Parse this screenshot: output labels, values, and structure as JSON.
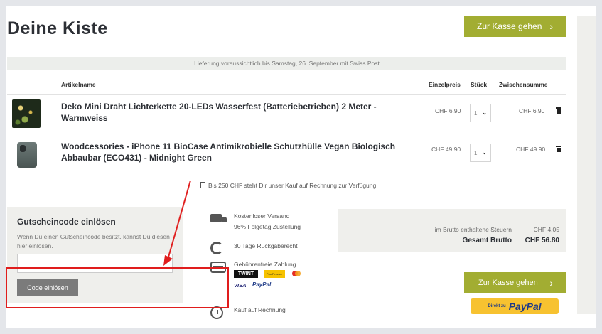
{
  "page": {
    "title": "Deine Kiste",
    "checkout_label": "Zur Kasse gehen",
    "chevron": "›",
    "delivery_note": "Lieferung voraussichtlich bis Samstag, 26. September mit Swiss Post"
  },
  "table": {
    "headers": [
      "Artikelname",
      "Einzelpreis",
      "Stück",
      "Zwischensumme"
    ],
    "rows": [
      {
        "name": "Deko Mini Draht Lichterkette 20-LEDs Wasserfest (Batteriebetrieben) 2 Meter - Warmweiss",
        "unit_price": "CHF 6.90",
        "qty": "1",
        "subtotal": "CHF 6.90"
      },
      {
        "name": "Woodcessories - iPhone 11 BioCase Antimikrobielle Schutzhülle Vegan Biologisch Abbaubar (ECO431) - Midnight Green",
        "unit_price": "CHF 49.90",
        "qty": "1",
        "subtotal": "CHF 49.90"
      }
    ]
  },
  "invoice_note": "Bis 250 CHF steht Dir unser Kauf auf Rechnung zur Verfügung!",
  "voucher": {
    "title": "Gutscheincode einlösen",
    "description": "Wenn Du einen Gutscheincode besitzt, kannst Du diesen hier einlösen.",
    "input_value": "",
    "button_label": "Code einlösen"
  },
  "features": [
    {
      "icon": "truck-icon",
      "line1": "Kostenloser Versand",
      "line2": "96% Folgetag Zustellung"
    },
    {
      "icon": "refresh-icon",
      "line1": "30 Tage Rückgaberecht",
      "line2": ""
    },
    {
      "icon": "credit-card-icon",
      "line1": "Gebührenfreie Zahlung",
      "line2": ""
    },
    {
      "icon": "clock-icon",
      "line1": "Kauf auf Rechnung",
      "line2": ""
    }
  ],
  "payment_logos": {
    "twint": "TWINT",
    "postfinance": "PostFinance",
    "visa": "VISA",
    "paypal": "PayPal"
  },
  "totals": {
    "tax_label": "im Brutto enthaltene Steuern",
    "tax_value": "CHF 4.05",
    "gross_label": "Gesamt Brutto",
    "gross_value": "CHF 56.80"
  },
  "paypal_button": {
    "prefix": "Direkt zu",
    "brand": "PayPal"
  },
  "colors": {
    "accent": "#a2ad32",
    "highlight": "#e01d1d",
    "panel": "#efefec"
  }
}
